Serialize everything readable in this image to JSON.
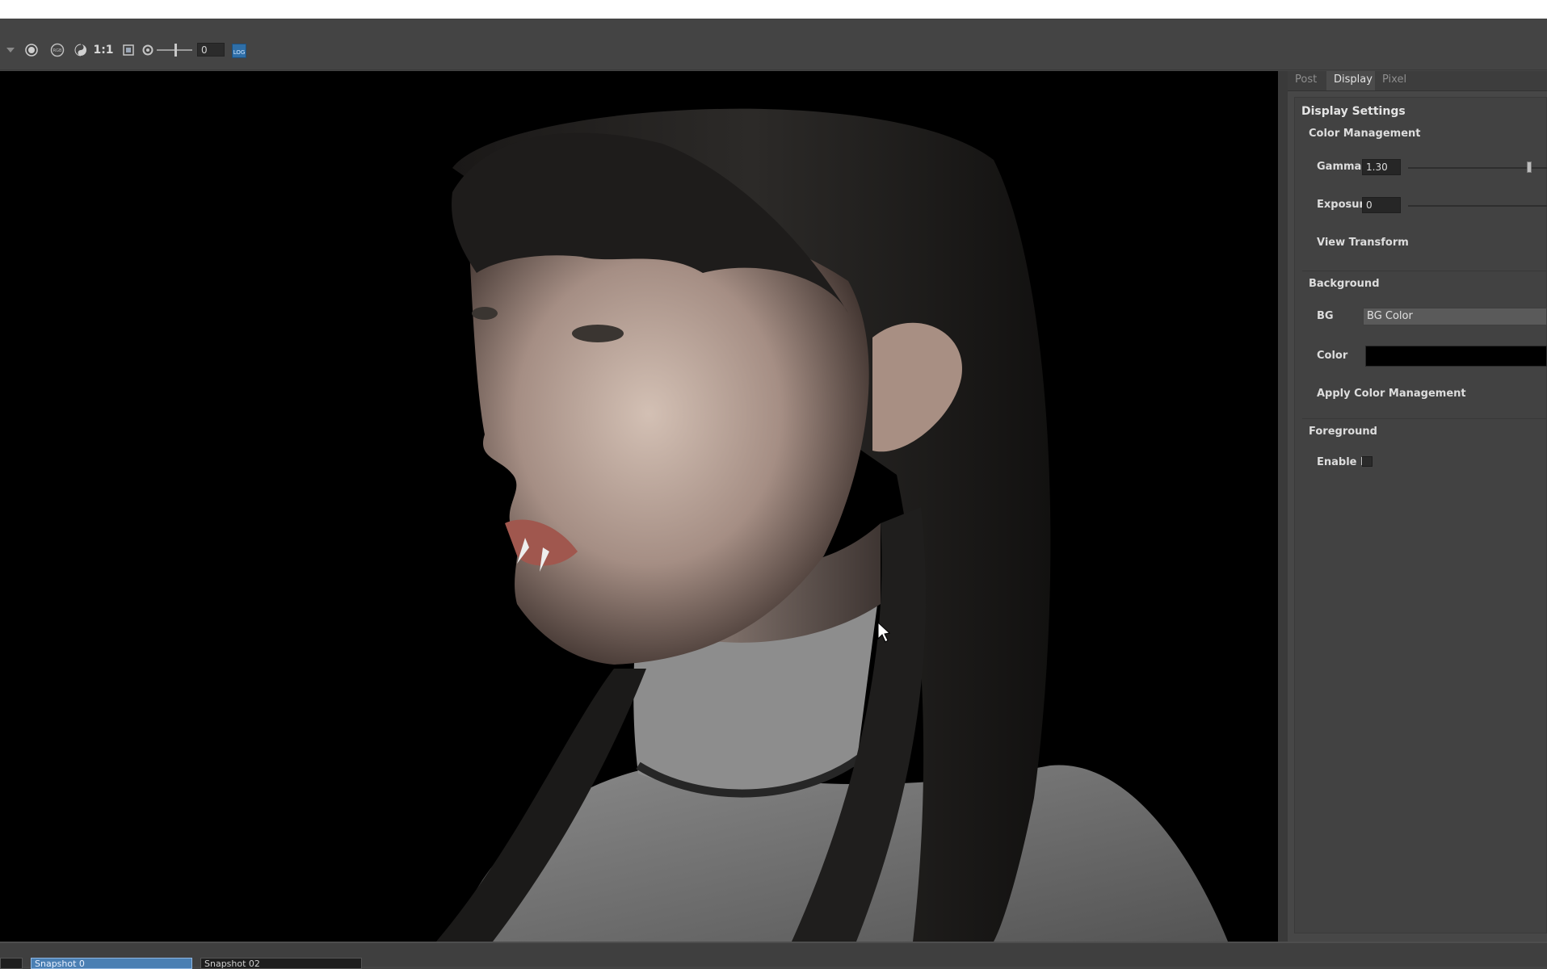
{
  "toolbar": {
    "ratio_label": "1:1",
    "exposure_value": "0",
    "log_label": "LOG",
    "icons": [
      "dropdown-arrow-icon",
      "sun-icon",
      "rgb-icon",
      "yinyang-icon",
      "frame-icon",
      "aperture-icon"
    ]
  },
  "panel": {
    "tabs": [
      {
        "label": "Post",
        "active": false
      },
      {
        "label": "Display",
        "active": true
      },
      {
        "label": "Pixel",
        "active": false
      }
    ],
    "title": "Display Settings",
    "color_management": {
      "header": "Color Management",
      "gamma_label": "Gamma",
      "gamma_value": "1.30",
      "exposure_label": "Exposur",
      "exposure_value": "0",
      "view_transform_label": "View Transform"
    },
    "background": {
      "header": "Background",
      "bg_label": "BG",
      "bg_value": "BG Color",
      "color_label": "Color",
      "color_value": "#000000",
      "apply_label": "Apply Color Management"
    },
    "foreground": {
      "header": "Foreground",
      "enable_label": "Enable F"
    }
  },
  "snapshots": [
    {
      "label": "Snapshot 0",
      "selected": true
    },
    {
      "label": "Snapshot 02",
      "selected": false
    }
  ]
}
